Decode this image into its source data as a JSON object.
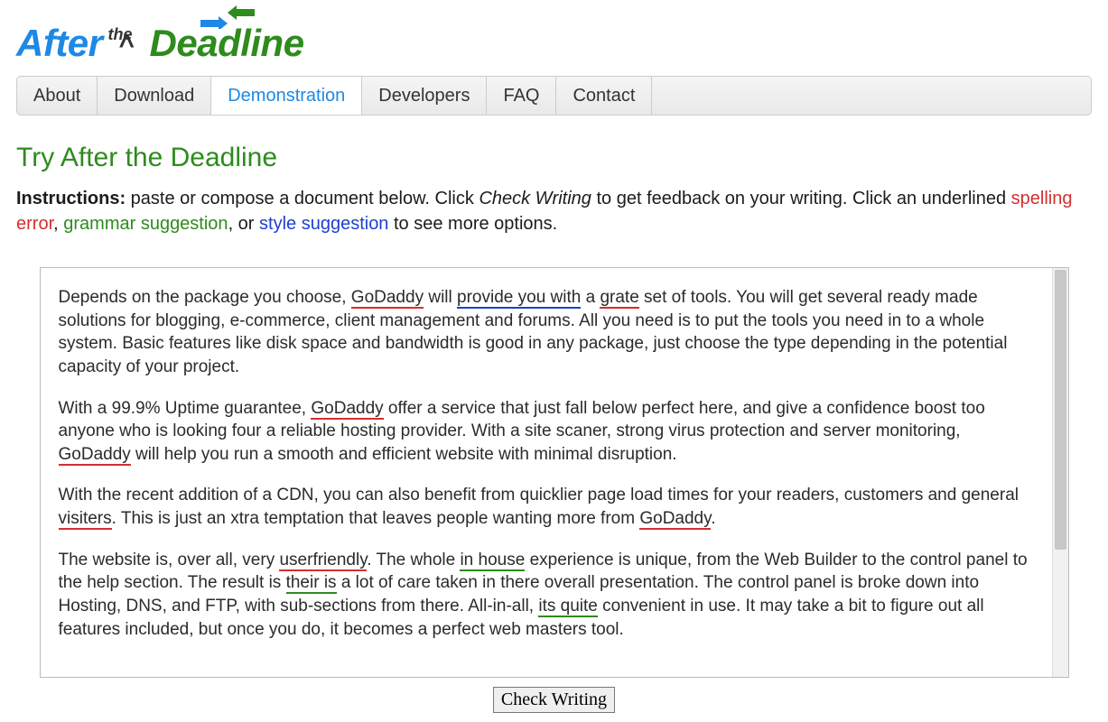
{
  "logo": {
    "after": "After",
    "the": "the",
    "deadline": "Deadline"
  },
  "nav": [
    "About",
    "Download",
    "Demonstration",
    "Developers",
    "FAQ",
    "Contact"
  ],
  "nav_active_index": 2,
  "title": "Try After the Deadline",
  "instructions": {
    "prefix": "Instructions:",
    "part1": " paste or compose a document below. Click ",
    "check_writing": "Check Writing",
    "part2": " to get feedback on your writing. Click an underlined ",
    "spelling": "spelling error",
    "sep1": ", ",
    "grammar": "grammar suggestion",
    "sep2": ", or ",
    "style": "style suggestion",
    "part3": " to see more options."
  },
  "content": {
    "p1_a": "Depends on the package you choose, ",
    "w_godaddy": "GoDaddy",
    "p1_b": " will ",
    "w_provide": "provide you with",
    "p1_c": " a ",
    "w_grate": "grate",
    "p1_d": " set of tools. You will get several ready made solutions for blogging, e-commerce, client management and forums. All you need is to put the tools you need in to a whole system. Basic features like disk space and bandwidth is good in any package, just choose the type depending in the potential capacity of your project.",
    "p2_a": "With a 99.9% Uptime guarantee, ",
    "p2_b": " offer a service that just fall below perfect here, and give a confidence boost too anyone who is looking four a reliable hosting provider. With a site scaner, strong virus protection and server monitoring, ",
    "p2_c": " will help you run a smooth and efficient website with minimal disruption.",
    "p3_a": "With the recent addition of a CDN, you can also benefit from quicklier page load times for your readers, customers and general ",
    "w_visiters": "visiters",
    "p3_b": ". This is just an xtra temptation that leaves people wanting more from ",
    "p3_c": ".",
    "p4_a": "The website is, over all, very ",
    "w_userfriendly": "userfriendly",
    "p4_b": ". The whole ",
    "w_inhouse": "in house",
    "p4_c": " experience is unique, from the Web Builder to the control panel to the help section. The result is ",
    "w_theiris": "their is",
    "p4_d": " a lot of care taken in there overall presentation. The control panel is broke down into Hosting, DNS, and FTP, with sub-sections from there. All-in-all, ",
    "w_itsquite": "its quite",
    "p4_e": " convenient in use. It may take a bit to figure out all features included, but once you do, it becomes a perfect web masters tool."
  },
  "button_label": "Check Writing"
}
